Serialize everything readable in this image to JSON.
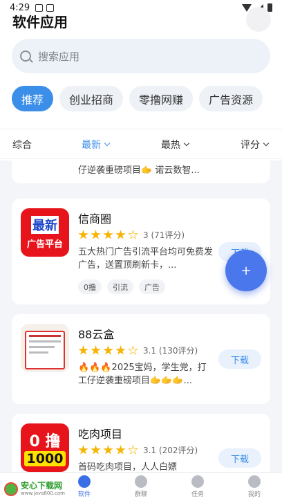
{
  "status_bar": {
    "time": "4:29"
  },
  "header": {
    "title": "软件应用"
  },
  "search": {
    "placeholder": "搜索应用"
  },
  "categories": [
    "推荐",
    "创业招商",
    "零撸网赚",
    "广告资源"
  ],
  "sort_tabs": [
    "综合",
    "最新",
    "最热",
    "评分"
  ],
  "partial_card": {
    "description": "仔逆袭重磅项目🫱 诺云数智..."
  },
  "apps": [
    {
      "icon_text": [
        "最新",
        "广告平台"
      ],
      "name": "信商圈",
      "rating": 4,
      "rating_text": "3 (71评分)",
      "description": "五大热门广告引流平台均可免费发广告，送置顶刷新卡，...",
      "tags": [
        "0撸",
        "引流",
        "广告"
      ],
      "button": "下载"
    },
    {
      "name": "88云盒",
      "rating": 4,
      "rating_text": "3.1 (130评分)",
      "description": "🔥🔥🔥2025宝妈，学生党，打工仔逆袭重磅项目🫱🫱🫱...",
      "button": "下载"
    },
    {
      "icon_text": [
        "0 撸",
        "1000"
      ],
      "name": "吃肉项目",
      "rating": 4,
      "rating_text": "3.1 (202评分)",
      "description": "首码吃肉项目，人人白嫖",
      "button": "下载"
    }
  ],
  "fab": {
    "label": "+"
  },
  "bottom_nav": [
    "软件",
    "群聊",
    "任务",
    "我的"
  ],
  "watermark": {
    "name": "安心下载网",
    "url": "www.java800.com"
  },
  "colors": {
    "accent": "#3b8fe9",
    "star": "#f5b400",
    "fab": "#4a78ec"
  }
}
